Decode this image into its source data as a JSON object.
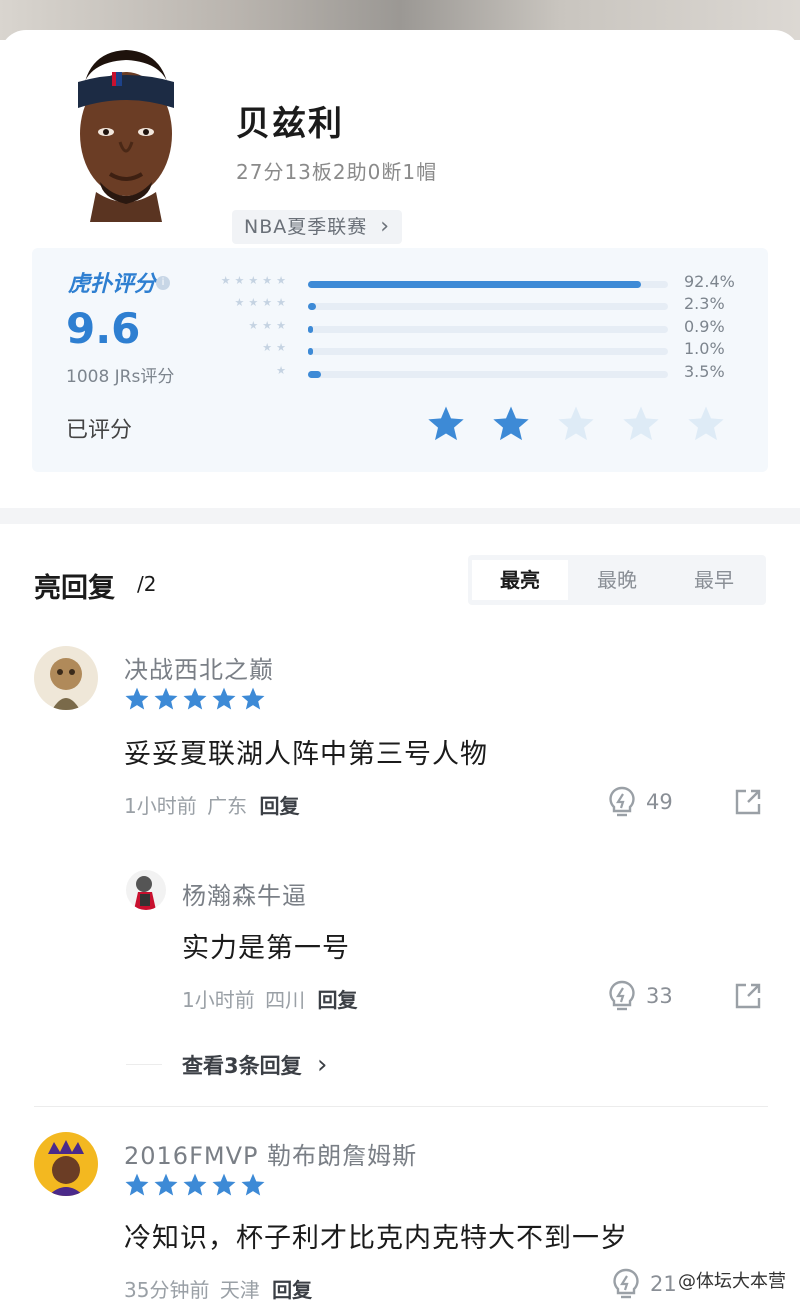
{
  "player": {
    "name": "贝兹利",
    "stats": "27分13板2助0断1帽",
    "league": "NBA夏季联赛",
    "league_arrow": "›"
  },
  "rating": {
    "brand": "虎扑评分",
    "info": "i",
    "score": "9.6",
    "count": "1008 JRs评分",
    "rated_label": "已评分",
    "distribution": [
      {
        "stars": "★★★★★",
        "pct_label": "92.4%",
        "value": 92.4
      },
      {
        "stars": "★★★★",
        "pct_label": "2.3%",
        "value": 2.3
      },
      {
        "stars": "★★★",
        "pct_label": "0.9%",
        "value": 0.9
      },
      {
        "stars": "★★",
        "pct_label": "1.0%",
        "value": 1.0
      },
      {
        "stars": "★",
        "pct_label": "3.5%",
        "value": 3.5
      }
    ],
    "my_rating": 2,
    "accent": "#3d8ad6"
  },
  "replies": {
    "title": "亮回复",
    "count": "/2",
    "tabs": [
      {
        "label": "最亮",
        "active": true
      },
      {
        "label": "最晚",
        "active": false
      },
      {
        "label": "最早",
        "active": false
      }
    ],
    "comments": [
      {
        "user": "决战西北之巅",
        "stars": 5,
        "text": "妥妥夏联湖人阵中第三号人物",
        "time": "1小时前",
        "location": "广东",
        "reply_label": "回复",
        "likes": "49"
      },
      {
        "user": "2016FMVP 勒布朗詹姆斯",
        "stars": 5,
        "text": "冷知识，杯子利才比克内克特大不到一岁",
        "time": "35分钟前",
        "location": "天津",
        "reply_label": "回复",
        "likes": "21"
      }
    ],
    "sub_reply": {
      "user": "杨瀚森牛逼",
      "text": "实力是第一号",
      "time": "1小时前",
      "location": "四川",
      "reply_label": "回复",
      "likes": "33"
    },
    "view_more": "查看3条回复",
    "view_more_arrow": "›"
  },
  "watermark": "@体坛大本营"
}
